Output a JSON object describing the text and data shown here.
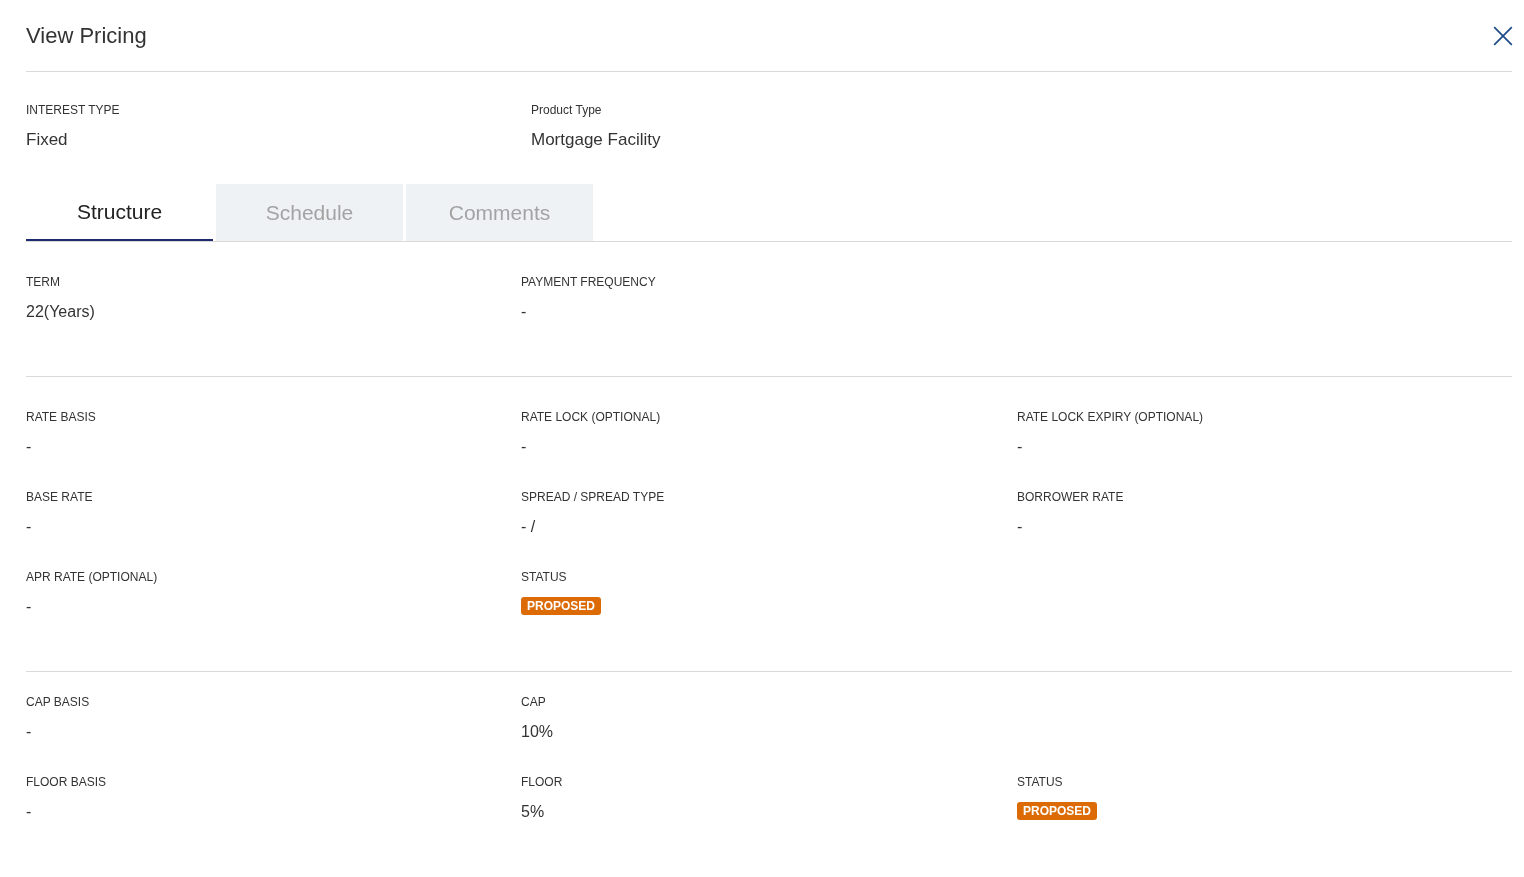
{
  "window": {
    "title": "View Pricing"
  },
  "summary": [
    {
      "label": "INTEREST TYPE",
      "value": "Fixed"
    },
    {
      "label": "Product Type",
      "value": "Mortgage Facility"
    }
  ],
  "tabs": [
    {
      "label": "Structure",
      "selected": true
    },
    {
      "label": "Schedule",
      "selected": false
    },
    {
      "label": "Comments",
      "selected": false
    }
  ],
  "sections": [
    {
      "rows": [
        [
          {
            "label": "TERM",
            "kind": "text",
            "value": "22(Years)"
          },
          {
            "label": "PAYMENT FREQUENCY",
            "kind": "text",
            "value": "-"
          }
        ]
      ]
    },
    {
      "rows": [
        [
          {
            "label": "RATE BASIS",
            "kind": "text",
            "value": "-"
          },
          {
            "label": "RATE LOCK (OPTIONAL)",
            "kind": "text",
            "value": "-"
          },
          {
            "label": "RATE LOCK EXPIRY (OPTIONAL)",
            "kind": "text",
            "value": "-"
          }
        ],
        [
          {
            "label": "BASE RATE",
            "kind": "text",
            "value": "-"
          },
          {
            "label": "SPREAD / SPREAD TYPE",
            "kind": "text",
            "value": "- /"
          },
          {
            "label": "BORROWER RATE",
            "kind": "text",
            "value": "-"
          }
        ],
        [
          {
            "label": "APR RATE (OPTIONAL)",
            "kind": "text",
            "value": "-"
          },
          {
            "label": "STATUS",
            "kind": "badge",
            "value": "PROPOSED"
          }
        ]
      ]
    },
    {
      "rows": [
        [
          {
            "label": "CAP BASIS",
            "kind": "text",
            "value": "-"
          },
          {
            "label": "CAP",
            "kind": "text",
            "value": "10%"
          }
        ],
        [
          {
            "label": "FLOOR BASIS",
            "kind": "text",
            "value": "-"
          },
          {
            "label": "FLOOR",
            "kind": "text",
            "value": "5%"
          },
          {
            "label": "STATUS",
            "kind": "badge",
            "value": "PROPOSED"
          }
        ]
      ]
    }
  ]
}
